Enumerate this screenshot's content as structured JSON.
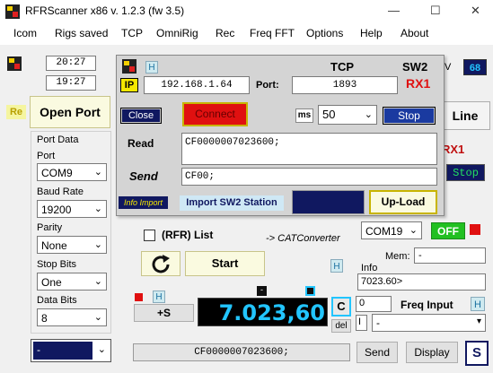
{
  "window": {
    "title": "RFRScanner  x86 v. 1.2.3   (fw 3.5)",
    "minimize": "—",
    "maximize": "☐",
    "close": "✕"
  },
  "menu": [
    "Icom",
    "Rigs saved",
    "TCP",
    "OmniRig",
    "Rec",
    "Freq FFT",
    "Options",
    "Help",
    "About"
  ],
  "times": {
    "time1": "20:27",
    "time2": "19:27"
  },
  "left": {
    "re": "Re",
    "open_port": "Open Port",
    "port_data_title": "Port Data",
    "port_label": "Port",
    "port_value": "COM9",
    "baud_label": "Baud Rate",
    "baud_value": "19200",
    "parity_label": "Parity",
    "parity_value": "None",
    "stop_label": "Stop Bits",
    "stop_value": "One",
    "data_label": "Data Bits",
    "data_value": "8",
    "bottom_select": "-"
  },
  "right": {
    "v_label": "V",
    "v_value": "68",
    "line_button": "Line",
    "rx1": "RX1",
    "stop": "Stop",
    "com_value": "COM19",
    "off": "OFF",
    "mem_label": "Mem:",
    "mem_value": "-",
    "info_label": "Info",
    "info_value": "7023.60>",
    "zero_value": "0",
    "freq_input_label": "Freq Input",
    "h": "H",
    "i_value": "I",
    "dropdown_value": "-",
    "del": "del"
  },
  "tcp": {
    "h": "H",
    "title": "TCP",
    "sw2": "SW2",
    "ip_label": "IP",
    "ip_value": "192.168.1.64",
    "port_label": "Port:",
    "port_value": "1893",
    "rx1": "RX1",
    "close": "Close",
    "connect": "Connect",
    "ms_label": "ms",
    "ms_value": "50",
    "stop": "Stop",
    "read_label": "Read",
    "read_value": "CF0000007023600;",
    "send_label": "Send",
    "send_value": "CF00;",
    "info_import": "Info Import",
    "import_station": "Import SW2 Station",
    "upload": "Up-Load"
  },
  "center": {
    "rfr_list": "(RFR) List",
    "cat_converter": "-> CATConverter",
    "start": "Start",
    "h": "H",
    "plus_s": "+S",
    "frequency": "7.023,60",
    "c": "C",
    "dash": "-"
  },
  "bottom": {
    "command": "CF0000007023600;",
    "send": "Send",
    "display": "Display",
    "s": "S"
  },
  "colors": {
    "dark_navy": "#101860",
    "freq_text": "#22c5ff",
    "red": "#e01010",
    "green": "#22c022",
    "yellow_border": "#c8b400"
  }
}
